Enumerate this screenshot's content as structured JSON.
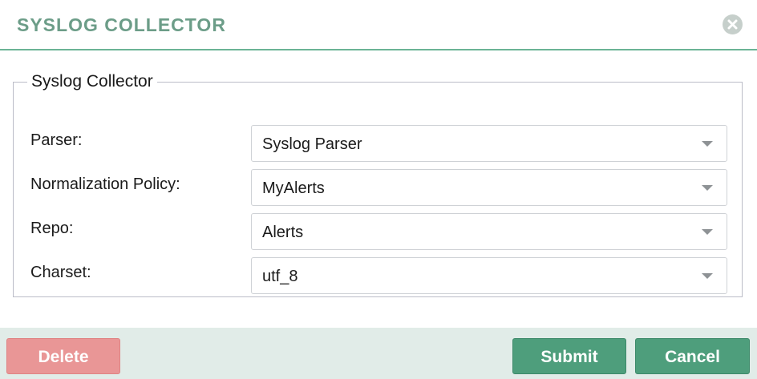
{
  "dialog": {
    "title": "SYSLOG COLLECTOR",
    "close_icon": "close-circle-icon"
  },
  "group": {
    "legend": "Syslog Collector",
    "fields": [
      {
        "label": "Parser:",
        "value": "Syslog Parser",
        "control": "dropdown"
      },
      {
        "label": "Normalization Policy:",
        "value": "MyAlerts",
        "control": "dropdown"
      },
      {
        "label": "Repo:",
        "value": "Alerts",
        "control": "dropdown"
      },
      {
        "label": "Charset:",
        "value": "utf_8",
        "control": "dropdown"
      }
    ]
  },
  "footer": {
    "delete_label": "Delete",
    "submit_label": "Submit",
    "cancel_label": "Cancel"
  },
  "colors": {
    "accent": "#6bb496",
    "title_text": "#6c9d88",
    "button_primary": "#4e9e7c",
    "button_danger": "#ea9595",
    "footer_background": "#e1ece8",
    "close_icon_background": "#c6cfcb"
  }
}
